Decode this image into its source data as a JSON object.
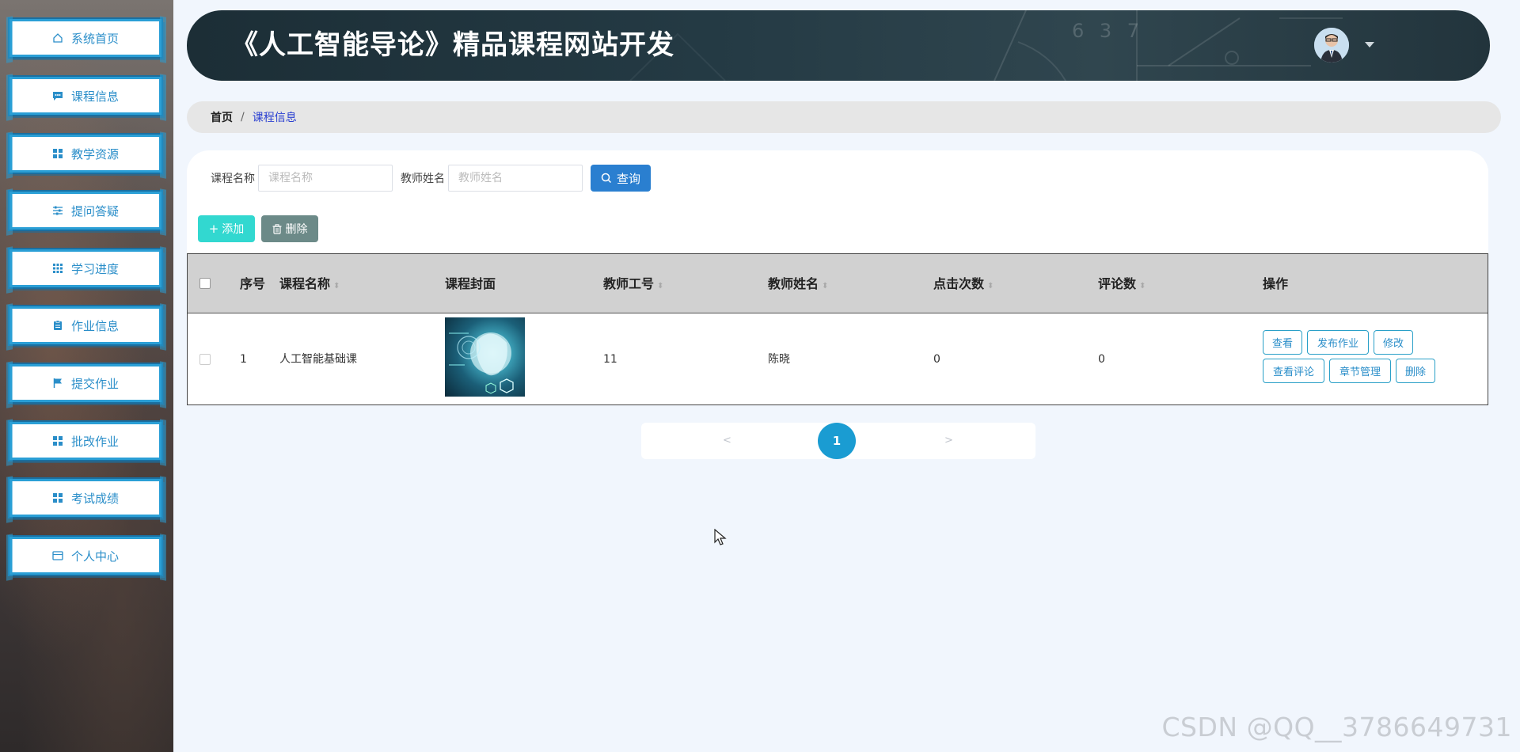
{
  "sidebar": {
    "items": [
      {
        "label": "系统首页",
        "icon": "home-icon"
      },
      {
        "label": "课程信息",
        "icon": "chat-icon"
      },
      {
        "label": "教学资源",
        "icon": "grid-icon"
      },
      {
        "label": "提问答疑",
        "icon": "sliders-icon"
      },
      {
        "label": "学习进度",
        "icon": "apps-icon"
      },
      {
        "label": "作业信息",
        "icon": "clipboard-icon"
      },
      {
        "label": "提交作业",
        "icon": "flag-icon"
      },
      {
        "label": "批改作业",
        "icon": "grid-icon"
      },
      {
        "label": "考试成绩",
        "icon": "grid-icon"
      },
      {
        "label": "个人中心",
        "icon": "card-icon"
      }
    ]
  },
  "header": {
    "title": "《人工智能导论》精品课程网站开发",
    "chalk_numbers": "6 3 7"
  },
  "breadcrumb": {
    "home": "首页",
    "separator": "/",
    "current": "课程信息"
  },
  "search": {
    "course_label": "课程名称",
    "course_placeholder": "课程名称",
    "teacher_label": "教师姓名",
    "teacher_placeholder": "教师姓名",
    "query_button": "查询"
  },
  "actions": {
    "add_button": "添加",
    "delete_button": "删除"
  },
  "table": {
    "columns": [
      "序号",
      "课程名称",
      "课程封面",
      "教师工号",
      "教师姓名",
      "点击次数",
      "评论数",
      "操作"
    ],
    "rows": [
      {
        "index": "1",
        "course_name": "人工智能基础课",
        "teacher_id": "11",
        "teacher_name": "陈晓",
        "clicks": "0",
        "comments": "0",
        "ops": {
          "view": "查看",
          "publish": "发布作业",
          "edit": "修改",
          "view_comments": "查看评论",
          "chapters": "章节管理",
          "delete": "删除"
        }
      }
    ]
  },
  "pagination": {
    "prev": "<",
    "current_page": "1",
    "next": ">"
  },
  "watermark": "CSDN @QQ__3786649731",
  "colors": {
    "accent": "#2a8ec9",
    "query_button": "#2a7fd0",
    "add_button": "#32d8d0",
    "delete_button": "#6c8a88",
    "page_active": "#1a9cd2",
    "header_bg": "#243a44"
  }
}
